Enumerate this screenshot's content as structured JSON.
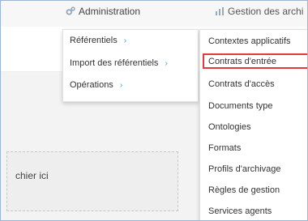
{
  "nav": {
    "admin_label": "Administration",
    "archive_label": "Gestion des archi"
  },
  "menu_level1": {
    "items": [
      {
        "label": "Référentiels",
        "has_submenu": true
      },
      {
        "label": "Import des référentiels",
        "has_submenu": true
      },
      {
        "label": "Opérations",
        "has_submenu": true
      }
    ],
    "arrow_glyph": "›"
  },
  "menu_level2": {
    "items": [
      {
        "label": "Contextes applicatifs"
      },
      {
        "label": "Contrats d'entrée",
        "selected": true
      },
      {
        "label": "Contrats d'accès"
      },
      {
        "label": "Documents type"
      },
      {
        "label": "Ontologies"
      },
      {
        "label": "Formats"
      },
      {
        "label": "Profils d'archivage"
      },
      {
        "label": "Règles de gestion"
      },
      {
        "label": "Services agents"
      }
    ]
  },
  "upload": {
    "text": "chier ici"
  },
  "colors": {
    "accent": "#2aa6d8",
    "highlight_border": "#e53a3a",
    "icon_gray": "#9aa9b8"
  },
  "icons": {
    "admin": "gear-icon",
    "archive": "bar-chart-icon",
    "submenu": "chevron-right-icon"
  }
}
